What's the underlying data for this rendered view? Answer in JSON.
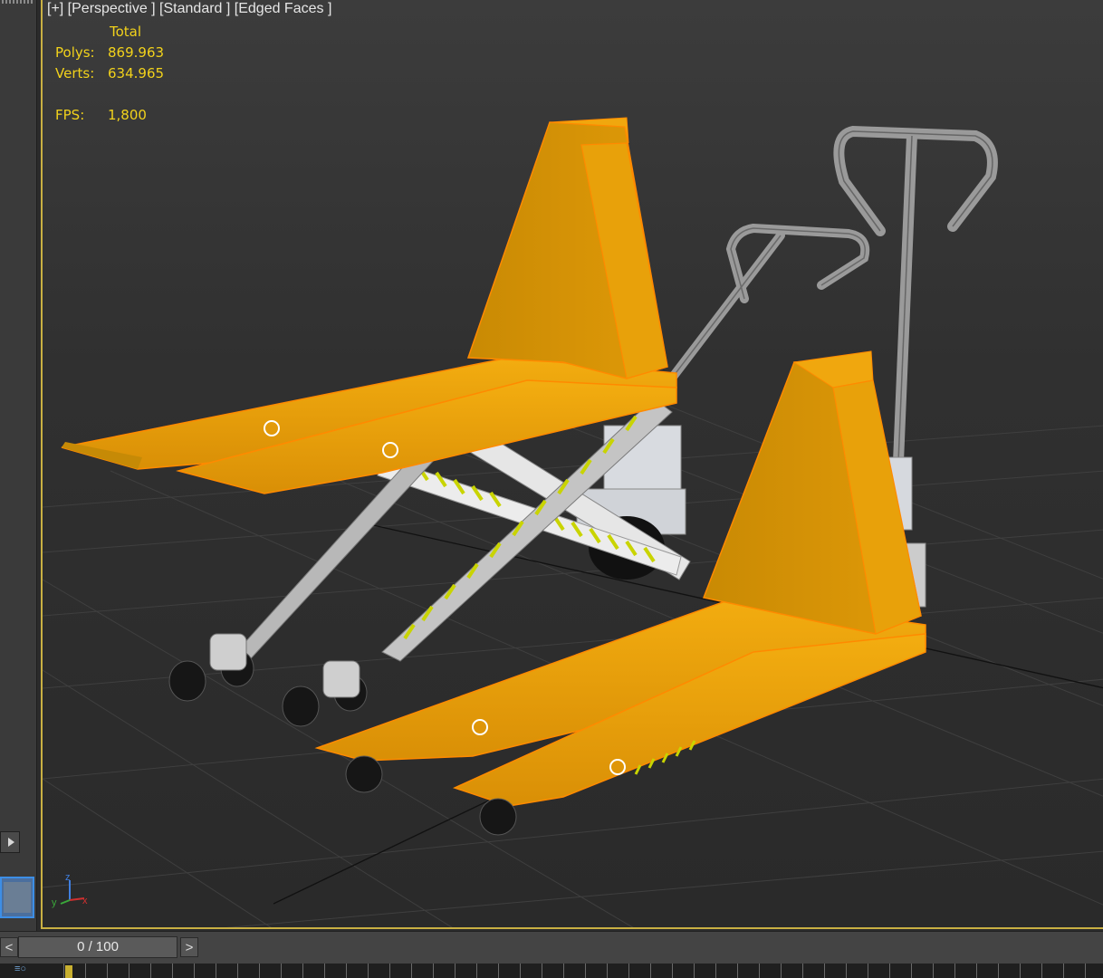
{
  "viewport": {
    "label": "[+] [Perspective ] [Standard ] [Edged Faces ]",
    "stats": {
      "header": "Total",
      "polys_label": "Polys:",
      "polys_value": "869.963",
      "verts_label": "Verts:",
      "verts_value": "634.965",
      "fps_label": "FPS:",
      "fps_value": "1,800"
    },
    "axis": {
      "z": "z",
      "y": "y",
      "x": "x"
    }
  },
  "timeline": {
    "prev_label": "<",
    "next_label": ">",
    "frame_display": "0 / 100"
  },
  "colors": {
    "viewport_border": "#c9b043",
    "stats_text": "#f2d21b",
    "model_orange": "#e9a30c",
    "model_outline": "#ff8a00"
  },
  "icons": {
    "play": "play-icon",
    "axis": "axis-gizmo-icon"
  }
}
